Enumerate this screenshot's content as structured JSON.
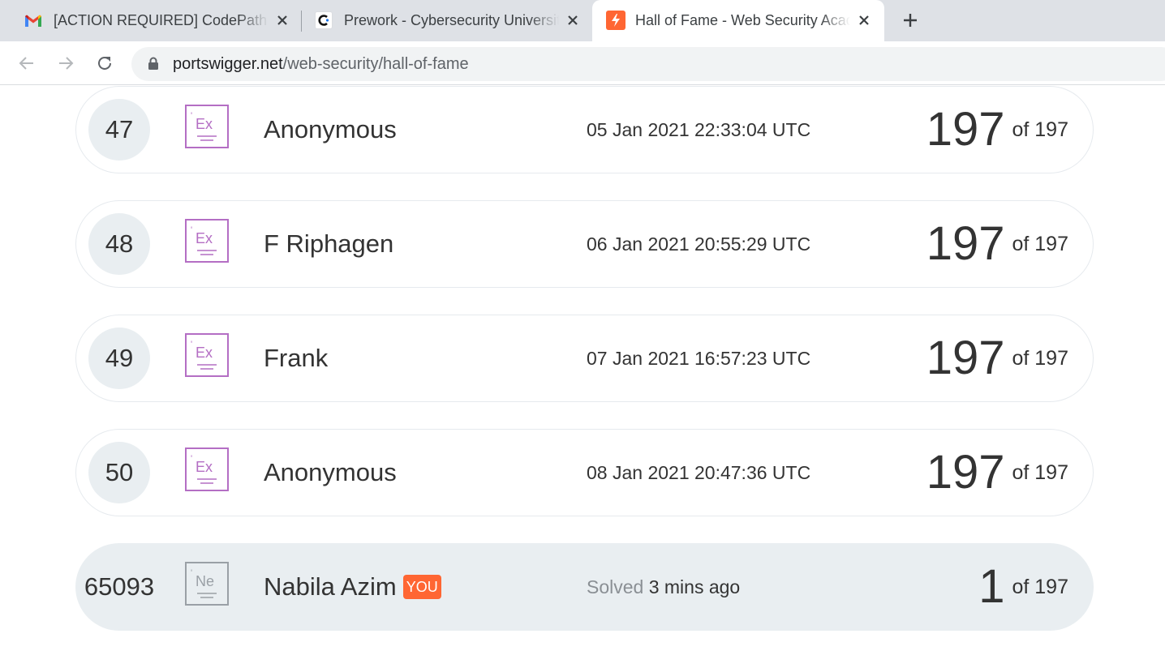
{
  "browser": {
    "tabs": [
      {
        "title": "[ACTION REQUIRED] CodePath application",
        "favicon": "gmail-icon",
        "active": false
      },
      {
        "title": "Prework - Cybersecurity University",
        "favicon": "codepath-icon",
        "active": false
      },
      {
        "title": "Hall of Fame - Web Security Academy",
        "favicon": "portswigger-icon",
        "active": true
      }
    ],
    "url_host": "portswigger.net",
    "url_path": "/web-security/hall-of-fame"
  },
  "leaderboard": {
    "rows": [
      {
        "rank": "47",
        "badge_text": "Ex",
        "name": "Anonymous",
        "date": "05 Jan 2021 22:33:04 UTC",
        "solved": "197",
        "of_label": "of 197"
      },
      {
        "rank": "48",
        "badge_text": "Ex",
        "name": "F Riphagen",
        "date": "06 Jan 2021 20:55:29 UTC",
        "solved": "197",
        "of_label": "of 197"
      },
      {
        "rank": "49",
        "badge_text": "Ex",
        "name": "Frank",
        "date": "07 Jan 2021 16:57:23 UTC",
        "solved": "197",
        "of_label": "of 197"
      },
      {
        "rank": "50",
        "badge_text": "Ex",
        "name": "Anonymous",
        "date": "08 Jan 2021 20:47:36 UTC",
        "solved": "197",
        "of_label": "of 197"
      }
    ],
    "current_user": {
      "rank": "65093",
      "badge_text": "Ne",
      "name": "Nabila Azim",
      "you_label": "YOU",
      "solved_label": "Solved",
      "solved_ago": "3 mins ago",
      "solved": "1",
      "of_label": "of 197"
    }
  },
  "colors": {
    "accent": "#ff6633",
    "expert_badge": "#b46ec4",
    "row_highlight": "#e9eef1"
  }
}
